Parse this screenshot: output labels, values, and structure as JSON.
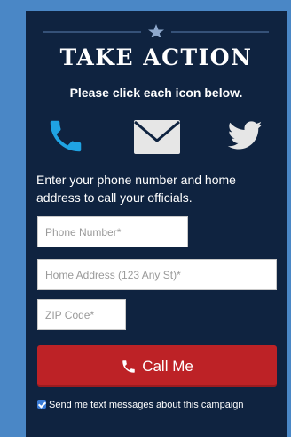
{
  "header": {
    "title": "TAKE ACTION",
    "subtitle": "Please click each icon below."
  },
  "icons": [
    {
      "name": "phone-icon",
      "color": "#1fa3e3"
    },
    {
      "name": "envelope-icon",
      "color": "#e6e6e6"
    },
    {
      "name": "twitter-icon",
      "color": "#e6e6e6"
    }
  ],
  "instructions": "Enter your phone number and home address to call your officials.",
  "form": {
    "phone_placeholder": "Phone Number*",
    "address_placeholder": "Home Address (123 Any St)*",
    "zip_placeholder": "ZIP Code*"
  },
  "call_button": {
    "label": "Call Me",
    "color": "#bd2226"
  },
  "optin": {
    "label": "Send me text messages about this campaign",
    "checked": true
  },
  "colors": {
    "page_bg": "#4a87c6",
    "panel_bg": "#0f2340",
    "accent": "#1fa3e3"
  }
}
